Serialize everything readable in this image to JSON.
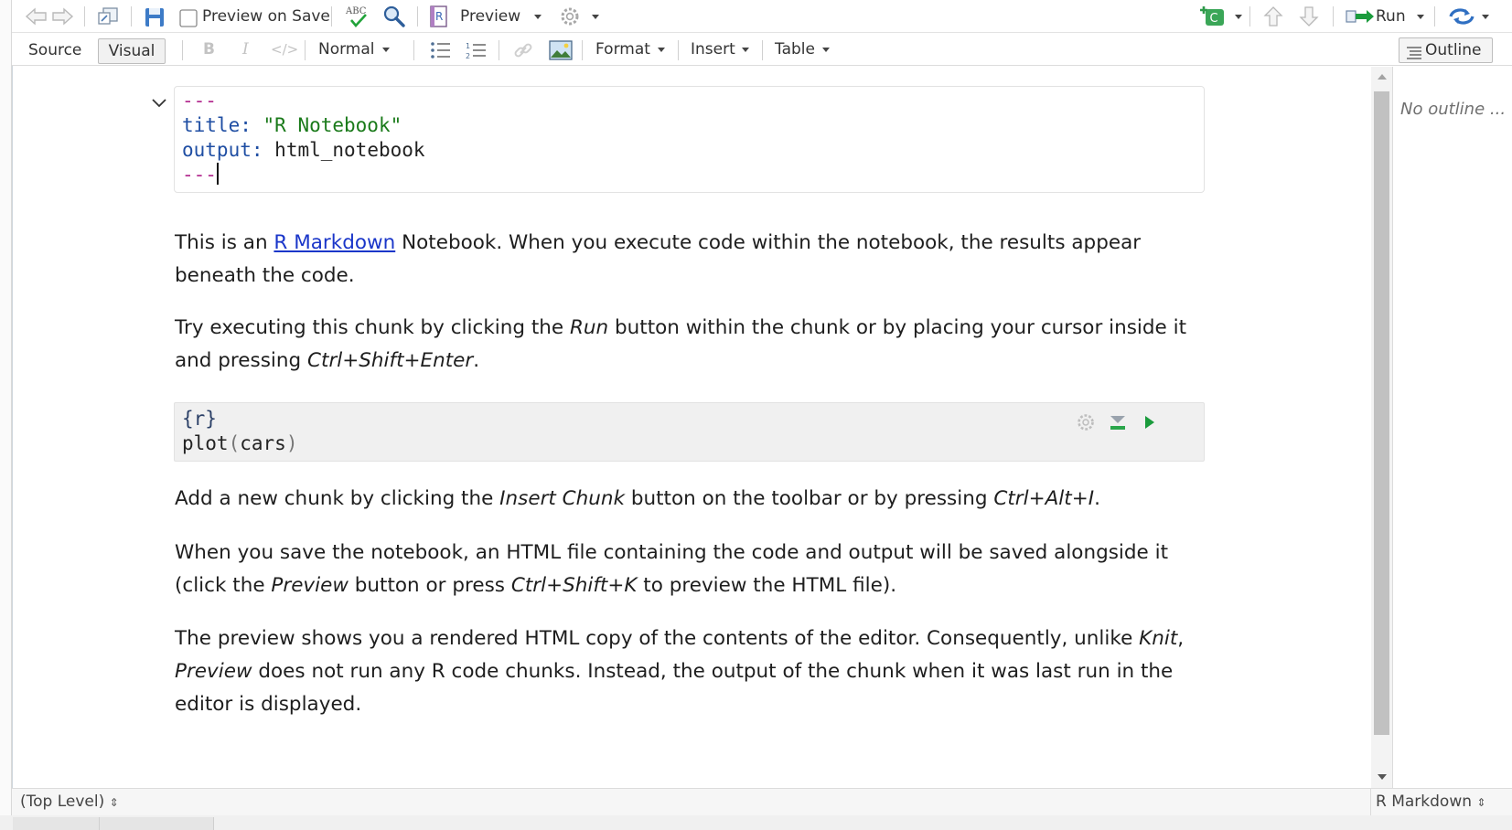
{
  "toolbar": {
    "preview_on_save_label": "Preview on Save",
    "preview_label": "Preview",
    "run_label": "Run",
    "spell_icon_text": "ABC",
    "r_badge": "R",
    "chunk_badge": "C"
  },
  "formatbar": {
    "source_label": "Source",
    "visual_label": "Visual",
    "bold_label": "B",
    "italic_label": "I",
    "code_label": "</>",
    "style_label": "Normal",
    "format_label": "Format",
    "insert_label": "Insert",
    "table_label": "Table",
    "outline_label": "Outline"
  },
  "yaml": {
    "dashes_top": "---",
    "title_key": "title:",
    "title_value": "\"R Notebook\"",
    "output_key": "output:",
    "output_value": "html_notebook",
    "dashes_bottom": "---"
  },
  "content": {
    "p1_before": "This is an ",
    "p1_link": "R Markdown",
    "p1_after": " Notebook. When you execute code within the notebook, the results appear beneath the code.",
    "p2_a": "Try executing this chunk by clicking the ",
    "p2_run": "Run",
    "p2_b": " button within the chunk or by placing your cursor inside it and pressing ",
    "p2_keys": "Ctrl+Shift+Enter",
    "p2_c": ".",
    "chunk_header": "{r}",
    "chunk_fn": "plot",
    "chunk_paren_open": "(",
    "chunk_arg": "cars",
    "chunk_paren_close": ")",
    "p3_a": "Add a new chunk by clicking the ",
    "p3_insert": "Insert Chunk",
    "p3_b": " button on the toolbar or by pressing ",
    "p3_keys": "Ctrl+Alt+I",
    "p3_c": ".",
    "p4_a": "When you save the notebook, an HTML file containing the code and output will be saved alongside it (click the ",
    "p4_preview": "Preview",
    "p4_b": " button or press ",
    "p4_keys": "Ctrl+Shift+K",
    "p4_c": " to preview the HTML file).",
    "p5_a": "The preview shows you a rendered HTML copy of the contents of the editor. Consequently, unlike ",
    "p5_knit": "Knit",
    "p5_b": ", ",
    "p5_preview": "Preview",
    "p5_c": " does not run any R code chunks. Instead, the output of the chunk when it was last run in the editor is displayed."
  },
  "outline": {
    "empty_text": "No outline ..."
  },
  "status": {
    "scope": "(Top Level)",
    "mode": "R Markdown"
  },
  "colors": {
    "link": "#1a36c9",
    "yaml_dash": "#b22b8f",
    "yaml_key": "#1f4ea3",
    "yaml_string": "#1a7a1a",
    "run_green": "#1a9b3c"
  }
}
